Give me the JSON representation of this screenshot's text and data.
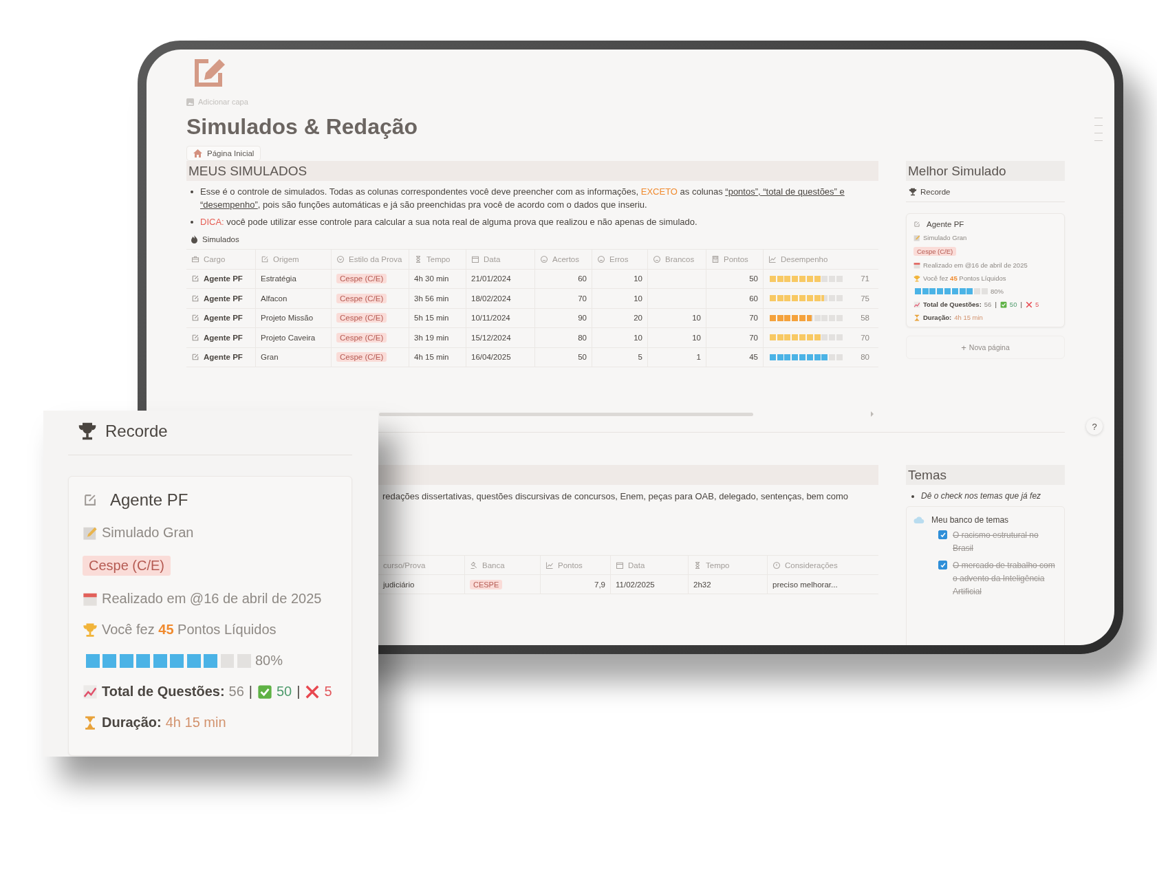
{
  "page": {
    "cover_action": "Adicionar capa",
    "title": "Simulados & Redação",
    "home_link": "Página Inicial",
    "help": "?"
  },
  "simulados": {
    "heading": "MEUS SIMULADOS",
    "bullets": [
      {
        "segments": [
          {
            "kind": "plain",
            "text": "Esse é o controle de simulados. Todas as colunas correspondentes você deve preencher com as informações, "
          },
          {
            "kind": "accent",
            "text": "EXCETO"
          },
          {
            "kind": "plain",
            "text": " as colunas "
          },
          {
            "kind": "underline",
            "text": "“pontos”, “total de questões” e “desempenho”"
          },
          {
            "kind": "plain",
            "text": ", pois são funções automáticas e já são preenchidas pra você de acordo com o dados que inseriu."
          }
        ]
      },
      {
        "segments": [
          {
            "kind": "alert",
            "text": "DICA:"
          },
          {
            "kind": "plain",
            "text": " você pode utilizar esse controle para calcular a sua nota real de alguma prova que realizou e não apenas de simulado."
          }
        ]
      }
    ],
    "database_title": "Simulados",
    "columns": [
      "Cargo",
      "Origem",
      "Estilo da Prova",
      "Tempo",
      "Data",
      "Acertos",
      "Erros",
      "Brancos",
      "Pontos",
      "Desempenho"
    ],
    "rows": [
      {
        "cargo": "Agente PF",
        "origem": "Estratégia",
        "estilo": "Cespe (C/E)",
        "tempo": "4h 30 min",
        "data": "21/01/2024",
        "acertos": "60",
        "erros": "10",
        "pontos": "50",
        "level": 0.71,
        "color": "#f8c964",
        "reading": "71"
      },
      {
        "cargo": "Agente PF",
        "origem": "Alfacon",
        "estilo": "Cespe (C/E)",
        "tempo": "3h 56 min",
        "data": "18/02/2024",
        "acertos": "70",
        "erros": "10",
        "pontos": "60",
        "level": 0.75,
        "color": "#f8c964",
        "reading": "75"
      },
      {
        "cargo": "Agente PF",
        "origem": "Projeto Missão",
        "estilo": "Cespe (C/E)",
        "tempo": "5h 15 min",
        "data": "10/11/2024",
        "acertos": "90",
        "erros": "20",
        "brancos": "10",
        "pontos": "70",
        "level": 0.58,
        "color": "#f4a23c",
        "reading": "58"
      },
      {
        "cargo": "Agente PF",
        "origem": "Projeto Caveira",
        "estilo": "Cespe (C/E)",
        "tempo": "3h 19 min",
        "data": "15/12/2024",
        "acertos": "80",
        "erros": "10",
        "brancos": "10",
        "pontos": "70",
        "level": 0.7,
        "color": "#f8c964",
        "reading": "70"
      },
      {
        "cargo": "Agente PF",
        "origem": "Gran",
        "estilo": "Cespe (C/E)",
        "tempo": "4h 15 min",
        "data": "16/04/2025",
        "acertos": "50",
        "erros": "5",
        "brancos": "1",
        "pontos": "45",
        "level": 0.8,
        "color": "#4bb3e6",
        "reading": "80"
      }
    ]
  },
  "melhor": {
    "heading": "Melhor Simulado",
    "view_tab": "Recorde",
    "card": {
      "title": "Agente PF",
      "subtitle": "Simulado Gran",
      "tag": "Cespe (C/E)",
      "date": "Realizado em @16 de abril de 2025",
      "points": "Você fez **45** Pontos Líquidos",
      "level": 0.8,
      "reading": "80%",
      "total_label": "Total de Questões:",
      "total": "56",
      "separators": [
        "|",
        "|"
      ],
      "correct": "50",
      "wrong": "5",
      "duration_label": "Duração:",
      "duration": "4h 15 min"
    },
    "new_page_icon": "+",
    "new_page": "Nova página"
  },
  "redacao": {
    "paragraph": "redações dissertativas, questões discursivas de concursos, Enem, peças para OAB, delegado, sentenças, bem como",
    "columns": [
      "curso/Prova",
      "Banca",
      "Pontos",
      "Data",
      "Tempo",
      "Considerações"
    ],
    "rows": [
      {
        "concurso": "judiciário",
        "banca": "CESPE",
        "pontos": "7,9",
        "data": "11/02/2025",
        "tempo": "2h32",
        "consideracoes": "preciso melhorar..."
      }
    ]
  },
  "temas": {
    "heading": "Temas",
    "hint": "Dê o check nos temas que já fez",
    "bank_title": "Meu banco de temas",
    "items": [
      {
        "text": "O racismo estrutural no Brasil",
        "checked": true
      },
      {
        "text": "O mercado de trabalho com o advento da Inteligência Artificial",
        "checked": true
      }
    ]
  },
  "zoom": {
    "view_tab": "Recorde",
    "card": {
      "title": "Agente PF",
      "subtitle": "Simulado Gran",
      "tag": "Cespe (C/E)",
      "date": "Realizado em @16 de abril de 2025",
      "points": "Você fez **45** Pontos Líquidos",
      "level": 0.8,
      "reading": "80%",
      "total_label": "Total de Questões:",
      "total": "56",
      "separators": [
        "|",
        "|"
      ],
      "correct": "50",
      "wrong": "5",
      "duration_label": "Duração:",
      "duration": "4h 15 min"
    }
  }
}
